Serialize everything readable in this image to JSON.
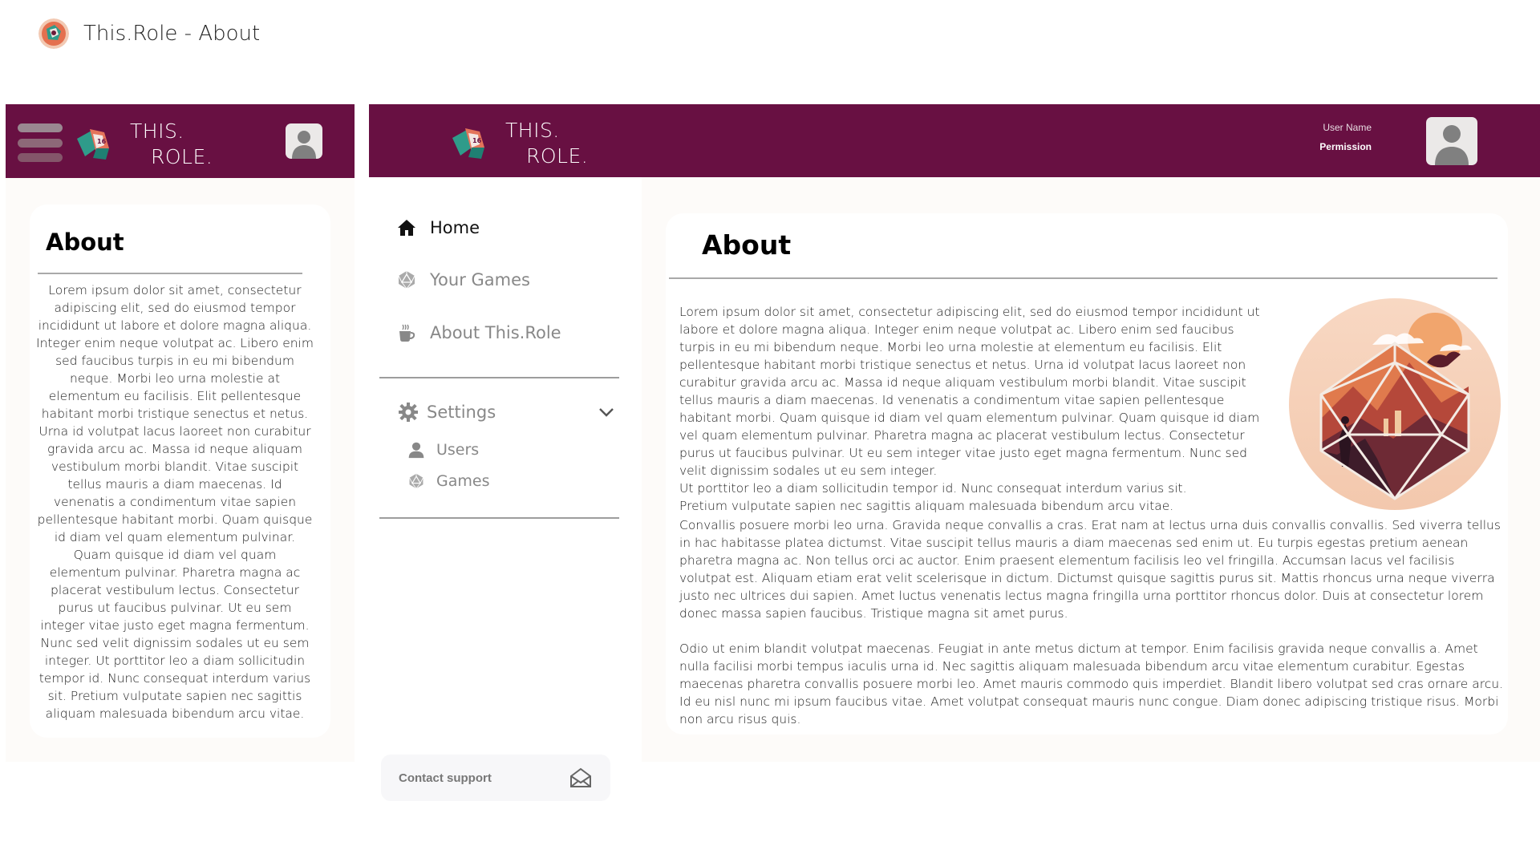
{
  "page": {
    "title": "This.Role - About"
  },
  "brand": {
    "line1": "THIS.",
    "line2": "ROLE."
  },
  "user": {
    "name": "User Name",
    "permission": "Permission"
  },
  "mobile": {
    "heading": "About",
    "body": "Lorem ipsum dolor sit amet, consectetur adipiscing elit, sed do eiusmod tempor incididunt ut labore et dolore magna aliqua. Integer enim neque volutpat ac. Libero enim sed faucibus turpis in eu mi bibendum neque. Morbi leo urna molestie at elementum eu facilisis. Elit pellentesque habitant morbi tristique senectus et netus. Urna id volutpat lacus laoreet non curabitur gravida arcu ac. Massa id neque aliquam vestibulum morbi blandit. Vitae suscipit tellus mauris a diam maecenas. Id venenatis a condimentum vitae sapien pellentesque habitant morbi. Quam quisque id diam vel quam elementum pulvinar. Quam quisque id diam vel quam elementum pulvinar. Pharetra magna ac placerat vestibulum lectus. Consectetur purus ut faucibus pulvinar. Ut eu sem integer vitae justo eget magna fermentum. Nunc sed velit dignissim sodales ut eu sem integer. Ut porttitor leo a diam sollicitudin tempor id. Nunc consequat interdum varius sit. Pretium vulputate sapien nec sagittis aliquam malesuada bibendum arcu vitae."
  },
  "sidebar": {
    "items": [
      {
        "label": "Home",
        "icon": "home-icon"
      },
      {
        "label": "Your Games",
        "icon": "d20-icon"
      },
      {
        "label": "About This.Role",
        "icon": "coffee-icon"
      }
    ],
    "settings": {
      "label": "Settings",
      "icon": "gear-icon",
      "sub_items": [
        {
          "label": "Users",
          "icon": "user-icon"
        },
        {
          "label": "Games",
          "icon": "d20-icon"
        }
      ]
    },
    "contact_support": "Contact support"
  },
  "content": {
    "heading": "About",
    "paragraph1": "Lorem ipsum dolor sit amet, consectetur adipiscing elit, sed do eiusmod tempor incididunt ut labore et dolore magna aliqua. Integer enim neque volutpat ac. Libero enim sed faucibus turpis in eu mi bibendum neque. Morbi leo urna molestie at elementum eu facilisis. Elit pellentesque habitant morbi tristique senectus et netus. Urna id volutpat lacus laoreet non curabitur gravida arcu ac. Massa id neque aliquam vestibulum morbi blandit. Vitae suscipit tellus mauris a diam maecenas. Id venenatis a condimentum vitae sapien pellentesque habitant morbi. Quam quisque id diam vel quam elementum pulvinar. Quam quisque id diam vel quam elementum pulvinar. Pharetra magna ac placerat vestibulum lectus. Consectetur purus ut faucibus pulvinar. Ut eu sem integer vitae justo eget magna fermentum. Nunc sed velit dignissim sodales ut eu sem integer.",
    "paragraph1b": "Ut porttitor leo a diam sollicitudin tempor id. Nunc consequat interdum varius sit.",
    "paragraph1c": "Pretium vulputate sapien nec sagittis aliquam malesuada bibendum arcu vitae.",
    "paragraph2": "Convallis posuere morbi leo urna. Gravida neque convallis a cras. Erat nam at lectus urna duis convallis convallis. Sed viverra tellus in hac habitasse platea dictumst. Vitae suscipit tellus mauris a diam maecenas sed enim ut. Eu turpis egestas pretium aenean pharetra magna ac. Non tellus orci ac auctor. Enim praesent elementum facilisis leo vel fringilla. Accumsan lacus vel facilisis volutpat est. Aliquam etiam erat velit scelerisque in dictum. Dictumst quisque sagittis purus sit. Mattis rhoncus urna neque viverra justo nec ultrices dui sapien. Amet luctus venenatis lectus magna fringilla urna porttitor rhoncus dolor. Duis at consectetur lorem donec massa sapien faucibus. Tristique magna sit amet purus.",
    "paragraph3": "Odio ut enim blandit volutpat maecenas. Feugiat in ante metus dictum at tempor. Enim facilisis gravida neque convallis a. Amet nulla facilisi morbi tempus iaculis urna id. Nec sagittis aliquam malesuada bibendum arcu vitae elementum curabitur. Egestas maecenas pharetra convallis posuere morbi leo. Amet mauris commodo quis imperdiet. Blandit libero volutpat sed cras ornare arcu. Id eu nisl nunc mi ipsum faucibus vitae. Amet volutpat consequat mauris nunc congue. Diam donec adipiscing tristique risus. Morbi non arcu risus quis."
  },
  "colors": {
    "brand": "#681042",
    "panel": "#fdfbf9",
    "muted_text": "#888888"
  }
}
